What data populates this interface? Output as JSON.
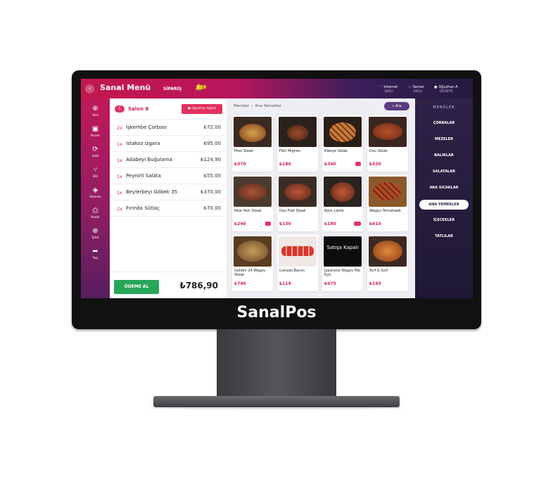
{
  "app": {
    "title": "Sanal Menü",
    "order_tab": "SİPARİŞ",
    "notification_count": "3",
    "brand": "SanalPos"
  },
  "status": {
    "internet": {
      "label": "Internet",
      "sub": "BAĞLI"
    },
    "server": {
      "label": "Server",
      "sub": "BAĞLI"
    },
    "user": {
      "label": "Oğuzhan A",
      "sub": "DEĞİŞTİR"
    }
  },
  "sidebar": {
    "items": [
      {
        "label": "Yeni",
        "icon": "plus-icon"
      },
      {
        "label": "İkram",
        "icon": "gift-icon"
      },
      {
        "label": "İade",
        "icon": "refresh-icon"
      },
      {
        "label": "Böl",
        "icon": "split-icon"
      },
      {
        "label": "İskonto",
        "icon": "tag-icon"
      },
      {
        "label": "Yazdır",
        "icon": "printer-icon"
      },
      {
        "label": "İptal",
        "icon": "cancel-icon"
      },
      {
        "label": "Taşı",
        "icon": "share-icon"
      }
    ]
  },
  "order": {
    "table_number": "5",
    "table_name": "Salon 8",
    "waiter_button": "Oğuzhan Ağralı",
    "lines": [
      {
        "qty": "2x",
        "name": "İşkembe Çorbası",
        "price": "₺72,00"
      },
      {
        "qty": "1x",
        "name": "Istakoz Izgara",
        "price": "₺95,00"
      },
      {
        "qty": "1x",
        "name": "Adabeyi Buğulama",
        "price": "₺124,90"
      },
      {
        "qty": "1x",
        "name": "Peynirli Salata",
        "price": "₺55,00"
      },
      {
        "qty": "1x",
        "name": "Beylerbeyi Göbek 35",
        "price": "₺370,00"
      },
      {
        "qty": "2x",
        "name": "Fırında Sütlaç",
        "price": "₺70,00"
      }
    ],
    "pay_button": "ÖDEME AL",
    "total": "₺786,90"
  },
  "products": {
    "breadcrumb": [
      "Menüler",
      "Ana Yemekler"
    ],
    "breadcrumb_sep": "›",
    "search_label": "Ara",
    "items": [
      {
        "name": "Pteo Steak",
        "price": "₺370"
      },
      {
        "name": "Filet Mignon",
        "price": "₺180"
      },
      {
        "name": "Ribeye Steak",
        "price": "₺340"
      },
      {
        "name": "Dou Steak",
        "price": "₺520"
      },
      {
        "name": "New York Steak",
        "price": "₺240"
      },
      {
        "name": "Dou Filet Steak",
        "price": "₺130"
      },
      {
        "name": "Rack Lamb",
        "price": "₺180"
      },
      {
        "name": "Wagyu Tomahawk",
        "price": "₺610"
      },
      {
        "name": "Golden 24 Wagyu Steak",
        "price": "₺740"
      },
      {
        "name": "Canada Bacon",
        "price": "₺119"
      },
      {
        "name": "Japanese Wagyu Rib Eye",
        "price": "₺475",
        "overlay": "Satışa Kapalı"
      },
      {
        "name": "Turf & Surf",
        "price": "₺165"
      }
    ]
  },
  "categories": {
    "header": "MENÜLER",
    "items": [
      "ÇORBALAR",
      "MEZELER",
      "BALIKLAR",
      "SALATALAR",
      "ARA SICAKLAR",
      "ANA YEMEKLER",
      "İÇECEKLER",
      "TATLILAR"
    ],
    "active_index": 5
  },
  "colors": {
    "accent": "#d21f58",
    "pay_green": "#28a55a",
    "category_bg": "#2e2246"
  }
}
